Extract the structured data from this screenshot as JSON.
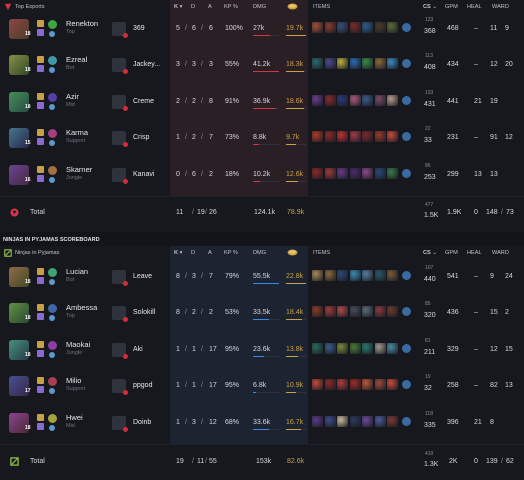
{
  "colors": {
    "blue_accent": "#3a88e8",
    "red_accent": "#d5334a",
    "gold": "#c9a04a",
    "neutral": "#2f333c"
  },
  "team1": {
    "name": "Top Esports",
    "logo_icon": "top-esports-logo-icon",
    "headers": {
      "k": "K",
      "d": "D",
      "a": "A",
      "kp": "KP %",
      "dmg": "DMG",
      "gold_icon": "gold-coins-icon",
      "items": "ITEMS",
      "cs": "CS",
      "gpm": "GPM",
      "heal": "HEAL",
      "ward": "WARD"
    },
    "rows": [
      {
        "champion": "Renekton",
        "role": "Top",
        "level": "18",
        "player": "369",
        "k": "5",
        "d": "6",
        "a": "6",
        "kp": "100%",
        "dmg": "27k",
        "dmg_frac": 0.65,
        "gold": "19.7k",
        "gold_frac": 0.98,
        "cs_top": "123",
        "cs": "368",
        "gpm": "468",
        "heal": "–",
        "ward": "11",
        "ward2": "9",
        "items": [
          "#a1503b",
          "#8a3c2c",
          "#3a4f7a",
          "#7a2a2a",
          "#2c5d8a",
          "#4a3b2d",
          "#5b6d3a"
        ]
      },
      {
        "champion": "Ezreal",
        "role": "Bot",
        "level": "18",
        "player": "Jackey...",
        "k": "3",
        "d": "3",
        "a": "3",
        "kp": "55%",
        "dmg": "41.2k",
        "dmg_frac": 1.0,
        "gold": "18.3k",
        "gold_frac": 0.9,
        "cs_top": "113",
        "cs": "408",
        "gpm": "434",
        "heal": "–",
        "ward": "12",
        "ward2": "20",
        "items": [
          "#2a6b6b",
          "#4a4a8a",
          "#b8b03a",
          "#2a6bb0",
          "#3a8a4a",
          "#8a6a3a",
          "#3a8ac0"
        ]
      },
      {
        "champion": "Azir",
        "role": "Mid",
        "level": "18",
        "player": "Creme",
        "k": "2",
        "d": "2",
        "a": "8",
        "kp": "91%",
        "dmg": "36.9k",
        "dmg_frac": 0.9,
        "gold": "18.6k",
        "gold_frac": 0.92,
        "cs_top": "133",
        "cs": "431",
        "gpm": "441",
        "heal": "21",
        "ward": "19",
        "ward2": "",
        "items": [
          "#6a3a8a",
          "#8a2a2a",
          "#2a3a7a",
          "#a85a7a",
          "#3a5a8a",
          "#7a4a6a",
          "#b89a8a"
        ]
      },
      {
        "champion": "Karma",
        "role": "Support",
        "level": "15",
        "player": "Crisp",
        "k": "1",
        "d": "2",
        "a": "7",
        "kp": "73%",
        "dmg": "8.8k",
        "dmg_frac": 0.21,
        "gold": "9.7k",
        "gold_frac": 0.48,
        "cs_top": "22",
        "cs": "33",
        "gpm": "231",
        "heal": "–",
        "ward": "91",
        "ward2": "12",
        "items": [
          "#b03a2a",
          "#8a2a2a",
          "#c03030",
          "#a03a4a",
          "#7a2a2a",
          "#9a3a2a",
          "#c84a3a"
        ]
      },
      {
        "champion": "Skarner",
        "role": "Jungle",
        "level": "16",
        "player": "Kanavi",
        "k": "0",
        "d": "6",
        "a": "2",
        "kp": "18%",
        "dmg": "10.2k",
        "dmg_frac": 0.25,
        "gold": "12.6k",
        "gold_frac": 0.62,
        "cs_top": "86",
        "cs": "253",
        "gpm": "299",
        "heal": "13",
        "ward": "13",
        "ward2": "",
        "items": [
          "#8a2a2a",
          "#a03a3a",
          "#6a3a8a",
          "#4a2a6a",
          "#8a4a8a",
          "#2a4a7a",
          "#3a7a4a"
        ]
      }
    ],
    "totals": {
      "label": "Total",
      "k": "11",
      "d": "19",
      "a": "26",
      "dmg": "124.1k",
      "gold": "78.9k",
      "cs_top": "477",
      "cs": "1.5K",
      "gpm": "1.9K",
      "heal": "0",
      "ward": "148",
      "ward2": "73"
    }
  },
  "section_title": "NINJAS IN PYJAMAS SCOREBOARD",
  "team2": {
    "name": "Ninjas in Pyjamas",
    "logo_icon": "ninjas-in-pyjamas-logo-icon",
    "headers": {
      "k": "K",
      "d": "D",
      "a": "A",
      "kp": "KP %",
      "dmg": "DMG",
      "gold_icon": "gold-coins-icon",
      "items": "ITEMS",
      "cs": "CS",
      "gpm": "GPM",
      "heal": "HEAL",
      "ward": "WARD"
    },
    "rows": [
      {
        "champion": "Lucian",
        "role": "Bot",
        "level": "18",
        "player": "Leave",
        "k": "8",
        "d": "3",
        "a": "7",
        "kp": "79%",
        "dmg": "55.5k",
        "dmg_frac": 1.0,
        "gold": "22.8k",
        "gold_frac": 1.0,
        "cs_top": "107",
        "cs": "440",
        "gpm": "541",
        "heal": "–",
        "ward": "9",
        "ward2": "24",
        "items": [
          "#a88a5a",
          "#8a6a3a",
          "#2a4a7a",
          "#3a8ab0",
          "#5a7aa0",
          "#2a5a6a",
          "#7a5a3a"
        ]
      },
      {
        "champion": "Ambessa",
        "role": "Top",
        "level": "18",
        "player": "Solokill",
        "k": "8",
        "d": "2",
        "a": "2",
        "kp": "53%",
        "dmg": "33.5k",
        "dmg_frac": 0.6,
        "gold": "18.4k",
        "gold_frac": 0.8,
        "cs_top": "85",
        "cs": "320",
        "gpm": "436",
        "heal": "–",
        "ward": "15",
        "ward2": "2",
        "items": [
          "#8a3a2a",
          "#a03a3a",
          "#b04a4a",
          "#4a4a5a",
          "#5a6a7a",
          "#8a3a3a",
          "#6a3a2a"
        ]
      },
      {
        "champion": "Maokai",
        "role": "Jungle",
        "level": "18",
        "player": "Aki",
        "k": "1",
        "d": "1",
        "a": "17",
        "kp": "95%",
        "dmg": "23.6k",
        "dmg_frac": 0.43,
        "gold": "13.8k",
        "gold_frac": 0.6,
        "cs_top": "81",
        "cs": "211",
        "gpm": "329",
        "heal": "–",
        "ward": "12",
        "ward2": "15",
        "items": [
          "#2a6a5a",
          "#3a5a8a",
          "#7a8a3a",
          "#4a7a3a",
          "#2a7a6a",
          "#a09a8a",
          "#4a8aa0"
        ]
      },
      {
        "champion": "Milio",
        "role": "Support",
        "level": "17",
        "player": "ppgod",
        "k": "1",
        "d": "1",
        "a": "17",
        "kp": "95%",
        "dmg": "6.8k",
        "dmg_frac": 0.12,
        "gold": "10.9k",
        "gold_frac": 0.48,
        "cs_top": "19",
        "cs": "32",
        "gpm": "258",
        "heal": "–",
        "ward": "82",
        "ward2": "13",
        "items": [
          "#c04a3a",
          "#8a2a2a",
          "#b03a3a",
          "#a02a2a",
          "#b85a3a",
          "#a04a3a",
          "#c84a3a"
        ]
      },
      {
        "champion": "Hwei",
        "role": "Mid",
        "level": "18",
        "player": "Doinb",
        "k": "1",
        "d": "3",
        "a": "12",
        "kp": "68%",
        "dmg": "33.6k",
        "dmg_frac": 0.6,
        "gold": "16.7k",
        "gold_frac": 0.73,
        "cs_top": "118",
        "cs": "335",
        "gpm": "396",
        "heal": "21",
        "ward": "8",
        "ward2": "",
        "items": [
          "#5a3a8a",
          "#3a4a8a",
          "#c8b8a0",
          "#2a3a5a",
          "#6a4a9a",
          "#4a5a9a",
          "#7a3a3a"
        ]
      }
    ],
    "totals": {
      "label": "Total",
      "k": "19",
      "d": "11",
      "a": "55",
      "dmg": "153k",
      "gold": "82.6k",
      "cs_top": "410",
      "cs": "1.3K",
      "gpm": "2K",
      "heal": "0",
      "ward": "139",
      "ward2": "62"
    }
  }
}
